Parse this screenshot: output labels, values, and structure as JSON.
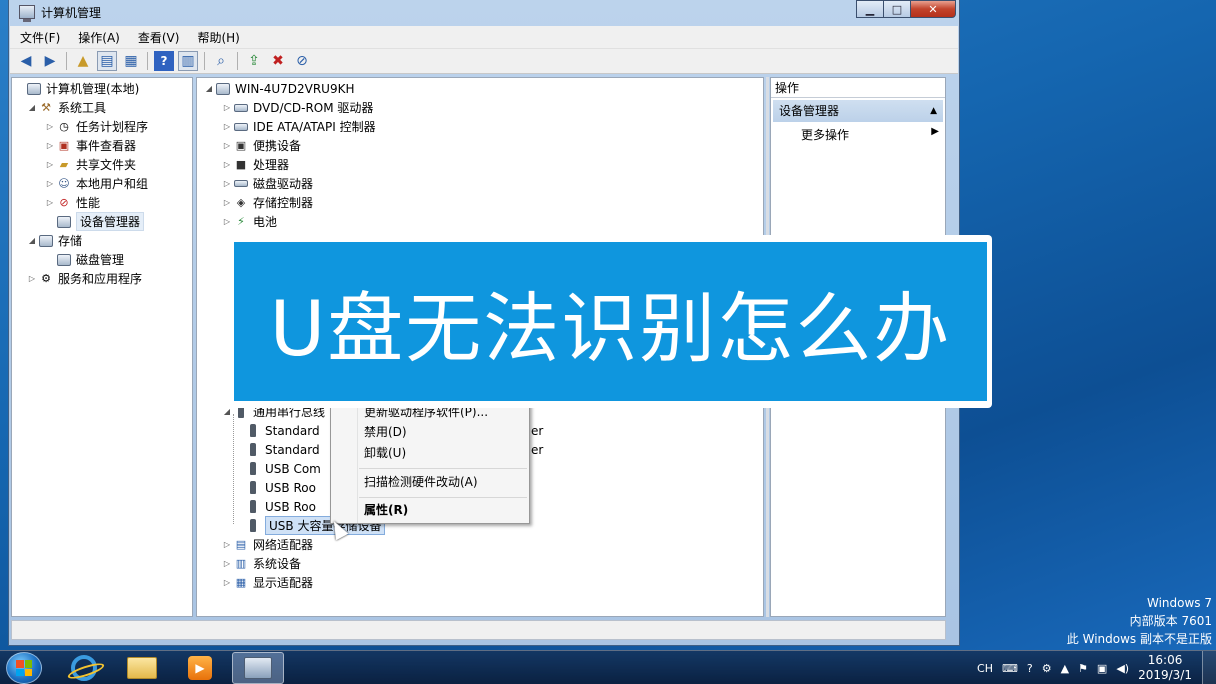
{
  "window": {
    "title": "计算机管理",
    "controls": {
      "minimize": "▁",
      "maximize": "□",
      "close": "✕"
    }
  },
  "menu": [
    "文件(F)",
    "操作(A)",
    "查看(V)",
    "帮助(H)"
  ],
  "left_tree": [
    {
      "label": "计算机管理(本地)",
      "icon": "computer-management-icon",
      "expander": ""
    },
    {
      "label": "系统工具",
      "icon": "system-tools-icon",
      "expander": "◢"
    },
    {
      "label": "任务计划程序",
      "icon": "clock-icon",
      "expander": "▷"
    },
    {
      "label": "事件查看器",
      "icon": "event-viewer-icon",
      "expander": "▷"
    },
    {
      "label": "共享文件夹",
      "icon": "shared-folder-icon",
      "expander": "▷"
    },
    {
      "label": "本地用户和组",
      "icon": "users-icon",
      "expander": "▷"
    },
    {
      "label": "性能",
      "icon": "performance-icon",
      "expander": "▷"
    },
    {
      "label": "设备管理器",
      "icon": "device-manager-icon",
      "expander": ""
    },
    {
      "label": "存储",
      "icon": "storage-icon",
      "expander": "◢"
    },
    {
      "label": "磁盘管理",
      "icon": "disk-management-icon",
      "expander": ""
    },
    {
      "label": "服务和应用程序",
      "icon": "services-icon",
      "expander": "▷"
    }
  ],
  "device_tree": {
    "root": "WIN-4U7D2VRU9KH",
    "top": [
      "DVD/CD-ROM 驱动器",
      "IDE ATA/ATAPI 控制器",
      "便携设备",
      "处理器",
      "磁盘驱动器",
      "存储控制器",
      "电池"
    ],
    "usb_controllers_partial": "通用串行总线",
    "usb_children": [
      "Standard",
      "Standard",
      "USB Com",
      "USB Roo",
      "USB Roo"
    ],
    "usb_selected": "USB 大容量存储设备",
    "overflow_fragments": [
      "er",
      "er"
    ],
    "bottom": [
      "网络适配器",
      "系统设备",
      "显示适配器"
    ]
  },
  "context_menu": {
    "items": [
      "更新驱动程序软件(P)...",
      "禁用(D)",
      "卸载(U)",
      "扫描检测硬件改动(A)",
      "属性(R)"
    ]
  },
  "actions_pane": {
    "header": "操作",
    "section": "设备管理器",
    "more": "更多操作"
  },
  "banner": {
    "text": "U盘无法识别怎么办",
    "color": "#0f96de"
  },
  "watermark": [
    "Windows 7",
    "内部版本 7601",
    "此 Windows 副本不是正版"
  ],
  "taskbar": {
    "tray": {
      "lang": "CH",
      "time": "16:06",
      "date": "2019/3/1"
    }
  }
}
